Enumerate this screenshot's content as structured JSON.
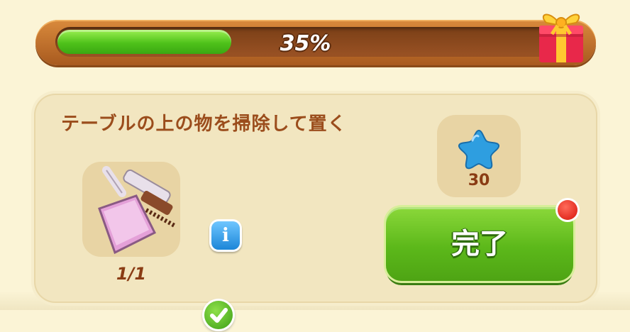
{
  "progress": {
    "value": 0.35,
    "label": "35%"
  },
  "task": {
    "title": "テーブルの上の物を掃除して置く",
    "item": {
      "icon": "dustpan-brush-icon",
      "count": "1/1",
      "info_label": "i",
      "completed": true
    },
    "reward": {
      "icon": "blue-star-icon",
      "amount": "30"
    },
    "complete_button_label": "完了"
  },
  "colors": {
    "progress_fill": "#4fc21a",
    "button_green": "#5cb81a",
    "title_brown": "#9b4d1c",
    "notification_red": "#d8140a"
  }
}
